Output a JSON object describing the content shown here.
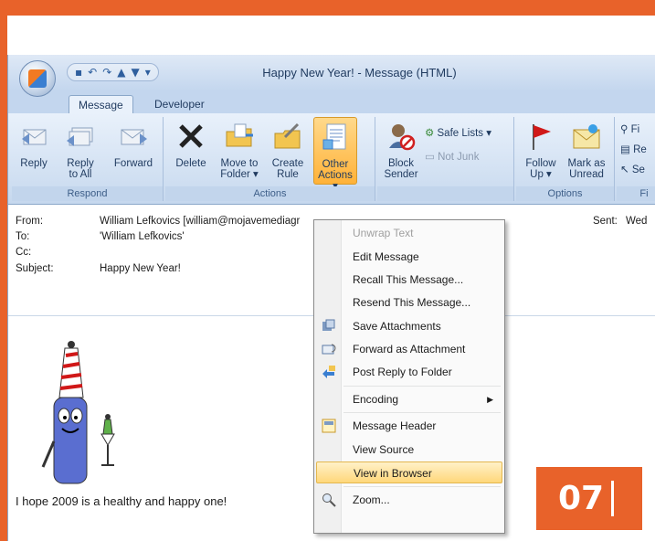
{
  "window": {
    "title": "Happy New Year! - Message (HTML)",
    "qat_icons": [
      "save-icon",
      "undo-icon",
      "redo-icon",
      "up-icon",
      "down-icon",
      "customize-icon"
    ]
  },
  "tabs": [
    {
      "label": "Message",
      "active": true
    },
    {
      "label": "Developer",
      "active": false
    }
  ],
  "ribbon": {
    "respond": {
      "label": "Respond",
      "reply": "Reply",
      "reply_all_1": "Reply",
      "reply_all_2": "to All",
      "forward": "Forward"
    },
    "actions": {
      "label": "Actions",
      "delete": "Delete",
      "move_1": "Move to",
      "move_2": "Folder ▾",
      "create_1": "Create",
      "create_2": "Rule",
      "other_1": "Other",
      "other_2": "Actions ▾"
    },
    "junk": {
      "block_1": "Block",
      "block_2": "Sender",
      "safe_lists": "Safe Lists ▾",
      "not_junk": "Not Junk"
    },
    "options": {
      "label": "Options",
      "follow_1": "Follow",
      "follow_2": "Up ▾",
      "mark_1": "Mark as",
      "mark_2": "Unread"
    },
    "find": {
      "label": "Fi",
      "find": "Fi",
      "related": "Re",
      "select": "Se"
    }
  },
  "header": {
    "from_label": "From:",
    "from_value": "William Lefkovics [william@mojavemediagr",
    "to_label": "To:",
    "to_value": "'William Lefkovics'",
    "cc_label": "Cc:",
    "cc_value": "",
    "subject_label": "Subject:",
    "subject_value": "Happy New Year!",
    "sent_label": "Sent:",
    "sent_value": "Wed"
  },
  "body": {
    "greeting": "I hope 2009 is a healthy and happy one!"
  },
  "menu": {
    "items": [
      {
        "label": "Unwrap Text",
        "disabled": true,
        "icon": ""
      },
      {
        "label": "Edit Message",
        "disabled": false,
        "icon": ""
      },
      {
        "label": "Recall This Message...",
        "disabled": false,
        "icon": ""
      },
      {
        "label": "Resend This Message...",
        "disabled": false,
        "icon": ""
      },
      {
        "label": "Save Attachments",
        "disabled": false,
        "icon": "save-attachments-icon"
      },
      {
        "label": "Forward as Attachment",
        "disabled": false,
        "icon": "forward-attachment-icon"
      },
      {
        "label": "Post Reply to Folder",
        "disabled": false,
        "icon": "post-reply-icon"
      },
      {
        "label": "Encoding",
        "disabled": false,
        "icon": "",
        "submenu": true
      },
      {
        "label": "Message Header",
        "disabled": false,
        "icon": "message-header-icon"
      },
      {
        "label": "View Source",
        "disabled": false,
        "icon": ""
      },
      {
        "label": "View in Browser",
        "disabled": false,
        "icon": "",
        "hover": true
      },
      {
        "label": "Zoom...",
        "disabled": false,
        "icon": "zoom-icon"
      }
    ]
  },
  "badge": {
    "text": "07"
  },
  "colors": {
    "accent": "#e8622a",
    "ribbon": "#d1e0f2",
    "highlight": "#ffd77a"
  }
}
